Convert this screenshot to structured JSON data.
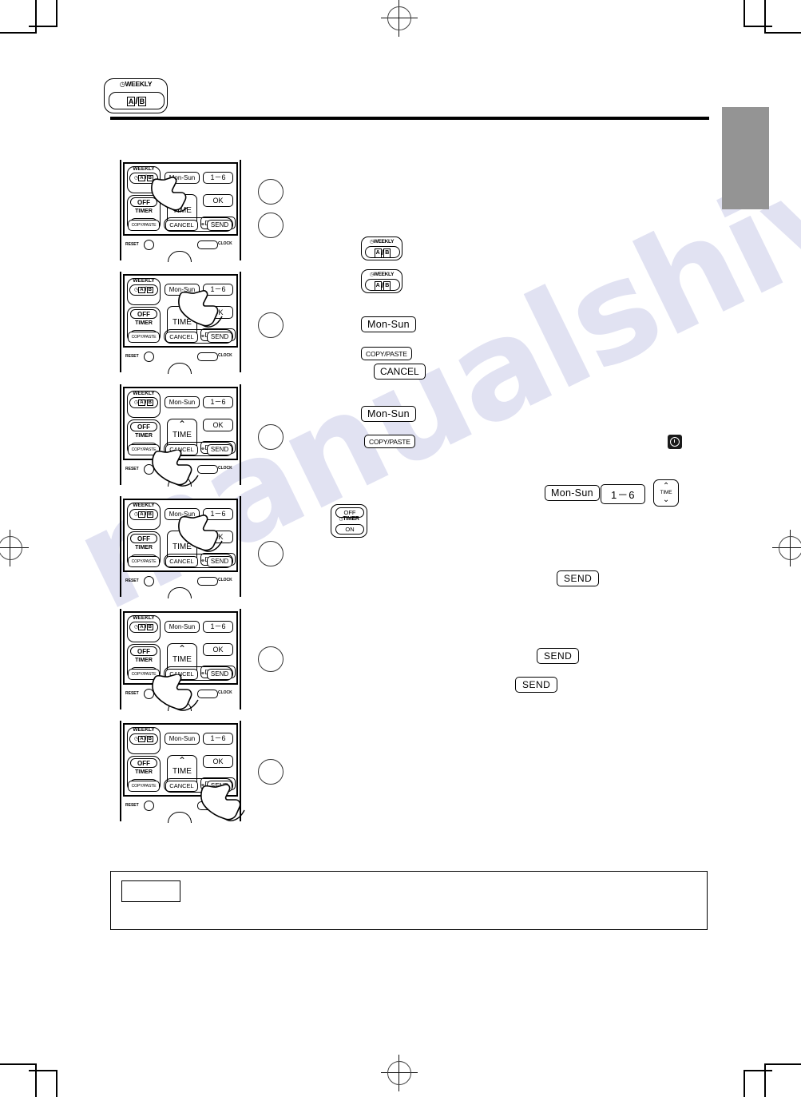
{
  "page": {
    "header_key": {
      "weekly_label": "WEEKLY",
      "a_label": "A",
      "separator": "/",
      "b_label": "B"
    },
    "note_box": {
      "caption": "",
      "body": ""
    },
    "watermark": "manualshive.com"
  },
  "remote": {
    "keys": {
      "weekly": "WEEKLY",
      "ab": {
        "a": "A",
        "sep": "/",
        "b": "B"
      },
      "mon_sun": "Mon-Sun",
      "one_six": "1－6",
      "off": "OFF",
      "timer": "TIMER",
      "on": "ON",
      "time": "TIME",
      "up_arrow": "⌃",
      "down_arrow": "⌄",
      "ok": "OK",
      "delete": "DELETE",
      "copy_paste": "COPY/PASTE",
      "cancel": "CANCEL",
      "send": "SEND",
      "reset": "RESET",
      "clock": "CLOCK"
    }
  },
  "steps": [
    {
      "index": 1,
      "number": "",
      "pointed_key": "ab",
      "circles": 2
    },
    {
      "index": 2,
      "number": "",
      "pointed_key": "mon-sun",
      "circles": 1
    },
    {
      "index": 3,
      "number": "",
      "pointed_key": "copy-paste",
      "circles": 1
    },
    {
      "index": 4,
      "number": "",
      "pointed_key": "mon-sun",
      "circles": 1
    },
    {
      "index": 5,
      "number": "",
      "pointed_key": "copy-paste",
      "circles": 1
    },
    {
      "index": 6,
      "number": "",
      "pointed_key": "send",
      "circles": 1
    }
  ],
  "inline_refs": {
    "weekly_ab_1": {
      "weekly": "WEEKLY",
      "a": "A",
      "sep": "/",
      "b": "B"
    },
    "weekly_ab_2": {
      "weekly": "WEEKLY",
      "a": "A",
      "sep": "/",
      "b": "B"
    },
    "mon_sun_1": "Mon-Sun",
    "copy_paste_1": "COPY/PASTE",
    "cancel_1": "CANCEL",
    "mon_sun_2": "Mon-Sun",
    "copy_paste_2": "COPY/PASTE",
    "clock_icon": "clock-icon",
    "mon_sun_3": "Mon-Sun",
    "one_six_1": "1－6",
    "time_1": {
      "up": "⌃",
      "label": "TIME",
      "down": "⌄"
    },
    "off_timer_on_1": {
      "off": "OFF",
      "timer": "TIMER",
      "on": "ON"
    },
    "send_1": "SEND",
    "send_2": "SEND",
    "send_3": "SEND"
  },
  "colors": {
    "ink": "#000000",
    "tab_gray": "#949494",
    "watermark": "#c9cbe8"
  }
}
